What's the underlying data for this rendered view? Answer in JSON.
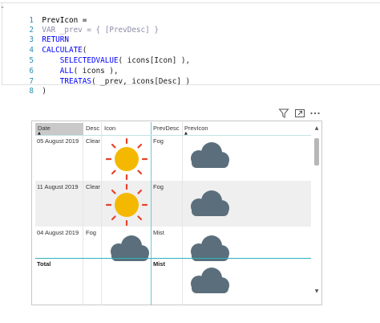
{
  "editor": {
    "lines": [
      {
        "num": "1",
        "text": "PrevIcon ="
      },
      {
        "num": "2",
        "kw": "VAR",
        "rest": " _prev = { [PrevDesc] }"
      },
      {
        "num": "3",
        "kw": "RETURN"
      },
      {
        "num": "4",
        "kw": "CALCULATE",
        "rest": "("
      },
      {
        "num": "5",
        "indent": "    ",
        "kw": "SELECTEDVALUE",
        "rest": "( icons[Icon] ),"
      },
      {
        "num": "6",
        "indent": "    ",
        "kw": "ALL",
        "rest": "( icons ),"
      },
      {
        "num": "7",
        "indent": "    ",
        "kw": "TREATAS",
        "rest": "( _prev, icons[Desc] )"
      },
      {
        "num": "8",
        "text": ")"
      }
    ]
  },
  "visual_header": {
    "filter_icon": "filter-icon",
    "focus_icon": "focus-mode-icon",
    "more_icon": "more-options-icon"
  },
  "table": {
    "columns": [
      "Date",
      "Desc",
      "Icon",
      "PrevDesc",
      "PrevIcon"
    ],
    "sort_arrow": "▲",
    "rows": [
      {
        "date": "05 August 2019",
        "desc": "Clear",
        "icon": "sun-icon",
        "prev_desc": "Fog",
        "prev_icon": "cloud-icon"
      },
      {
        "date": "11 August 2019",
        "desc": "Clear",
        "icon": "sun-icon",
        "prev_desc": "Fog",
        "prev_icon": "cloud-icon"
      },
      {
        "date": "04 August 2019",
        "desc": "Fog",
        "icon": "cloud-icon",
        "prev_desc": "Mist",
        "prev_icon": "cloud-icon"
      }
    ],
    "total": {
      "label": "Total",
      "prev_desc": "Mist",
      "prev_icon": "cloud-icon"
    }
  },
  "colors": {
    "sun": "#f5b800",
    "sun_rays": "#e8412b",
    "cloud": "#5a6f7b",
    "accent_teal": "#2fb0be",
    "keyword_blue": "#0000ff",
    "line_number": "#2b91af"
  }
}
